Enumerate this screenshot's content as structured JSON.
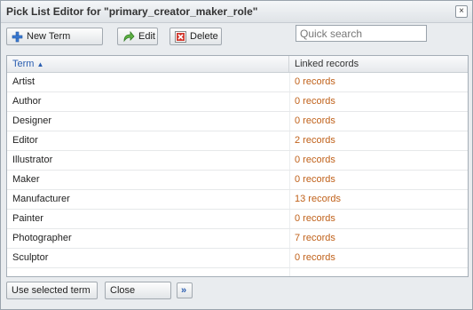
{
  "dialog": {
    "title": "Pick List Editor for \"primary_creator_maker_role\"",
    "close_glyph": "×"
  },
  "toolbar": {
    "new_term_label": "New Term",
    "edit_label": "Edit",
    "delete_label": "Delete",
    "search_placeholder": "Quick search"
  },
  "grid": {
    "columns": [
      "Term",
      "Linked records"
    ],
    "sorted_column": "Term",
    "sort_direction": "ascending",
    "rows": [
      {
        "term": "Artist",
        "linked": "0 records"
      },
      {
        "term": "Author",
        "linked": "0 records"
      },
      {
        "term": "Designer",
        "linked": "0 records"
      },
      {
        "term": "Editor",
        "linked": "2 records"
      },
      {
        "term": "Illustrator",
        "linked": "0 records"
      },
      {
        "term": "Maker",
        "linked": "0 records"
      },
      {
        "term": "Manufacturer",
        "linked": "13 records"
      },
      {
        "term": "Painter",
        "linked": "0 records"
      },
      {
        "term": "Photographer",
        "linked": "7 records"
      },
      {
        "term": "Sculptor",
        "linked": "0 records"
      }
    ]
  },
  "footer": {
    "use_selected_label": "Use selected term",
    "close_label": "Close",
    "more_label": "»"
  },
  "colors": {
    "link_blue": "#2a5db0",
    "record_orange": "#c0611a",
    "new_icon_blue": "#3a7bd5",
    "edit_icon_green": "#3c9a2e",
    "delete_icon_red": "#d23a2f"
  }
}
